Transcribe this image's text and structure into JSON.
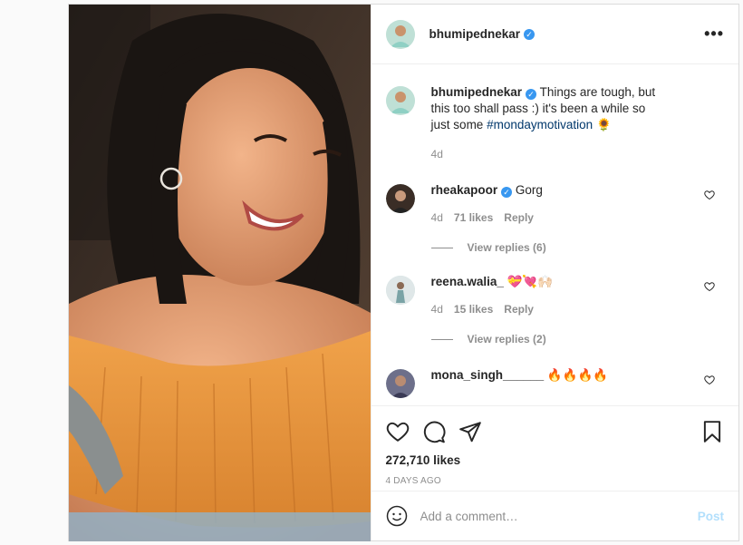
{
  "post": {
    "username": "bhumipednekar",
    "more_label": "•••",
    "caption": {
      "username": "bhumipednekar",
      "text": "Things are tough, but this too shall pass :) it's been a while so just some",
      "hashtag": "#mondaymotivation",
      "emoji": "🌻",
      "time": "4d"
    },
    "comments": [
      {
        "username": "rheakapoor",
        "verified": true,
        "text": "Gorg",
        "time": "4d",
        "likes": "71 likes",
        "reply": "Reply",
        "view_replies": "View replies (6)"
      },
      {
        "username": "reena.walia_",
        "verified": false,
        "text": "💝💘🙌🏻",
        "time": "4d",
        "likes": "15 likes",
        "reply": "Reply",
        "view_replies": "View replies (2)"
      },
      {
        "username": "mona_singh______",
        "verified": false,
        "text": "🔥🔥🔥🔥"
      }
    ],
    "likes_count": "272,710 likes",
    "posted_ago": "4 DAYS AGO",
    "comment_placeholder": "Add a comment…",
    "post_label": "Post"
  },
  "colors": {
    "link": "#00376b",
    "verified": "#3897f0",
    "muted": "#8e8e8e",
    "post_disabled": "#b2dffc"
  }
}
